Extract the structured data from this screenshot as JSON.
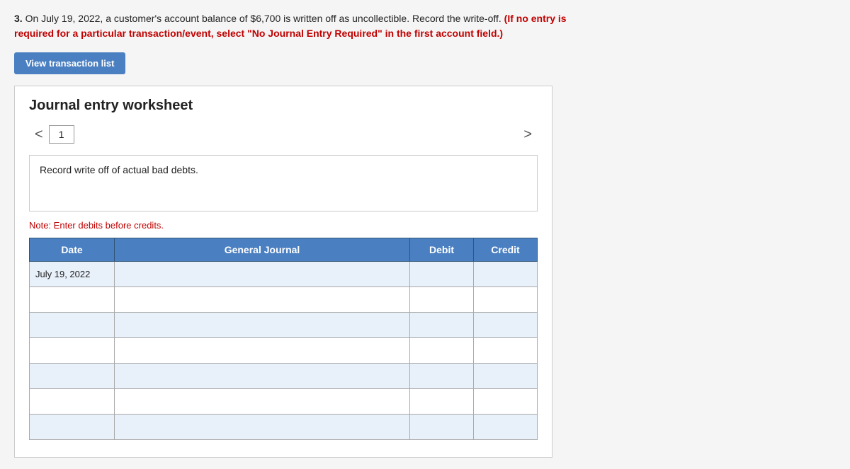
{
  "problem": {
    "number": "3.",
    "text": " On July 19, 2022, a customer's account balance of $6,700 is written off as uncollectible. Record the write-off.",
    "bold_red": "(If no entry is required for a particular transaction/event, select \"No Journal Entry Required\" in the first account field.)"
  },
  "view_btn": {
    "label": "View transaction list"
  },
  "worksheet": {
    "title": "Journal entry worksheet",
    "tab_number": "1",
    "description": "Record write off of actual bad debts.",
    "note": "Note: Enter debits before credits.",
    "table": {
      "headers": [
        "Date",
        "General Journal",
        "Debit",
        "Credit"
      ],
      "rows": [
        {
          "date": "July 19, 2022",
          "journal": "",
          "debit": "",
          "credit": ""
        },
        {
          "date": "",
          "journal": "",
          "debit": "",
          "credit": ""
        },
        {
          "date": "",
          "journal": "",
          "debit": "",
          "credit": ""
        },
        {
          "date": "",
          "journal": "",
          "debit": "",
          "credit": ""
        },
        {
          "date": "",
          "journal": "",
          "debit": "",
          "credit": ""
        },
        {
          "date": "",
          "journal": "",
          "debit": "",
          "credit": ""
        },
        {
          "date": "",
          "journal": "",
          "debit": "",
          "credit": ""
        }
      ]
    }
  },
  "nav": {
    "left_arrow": "<",
    "right_arrow": ">"
  }
}
